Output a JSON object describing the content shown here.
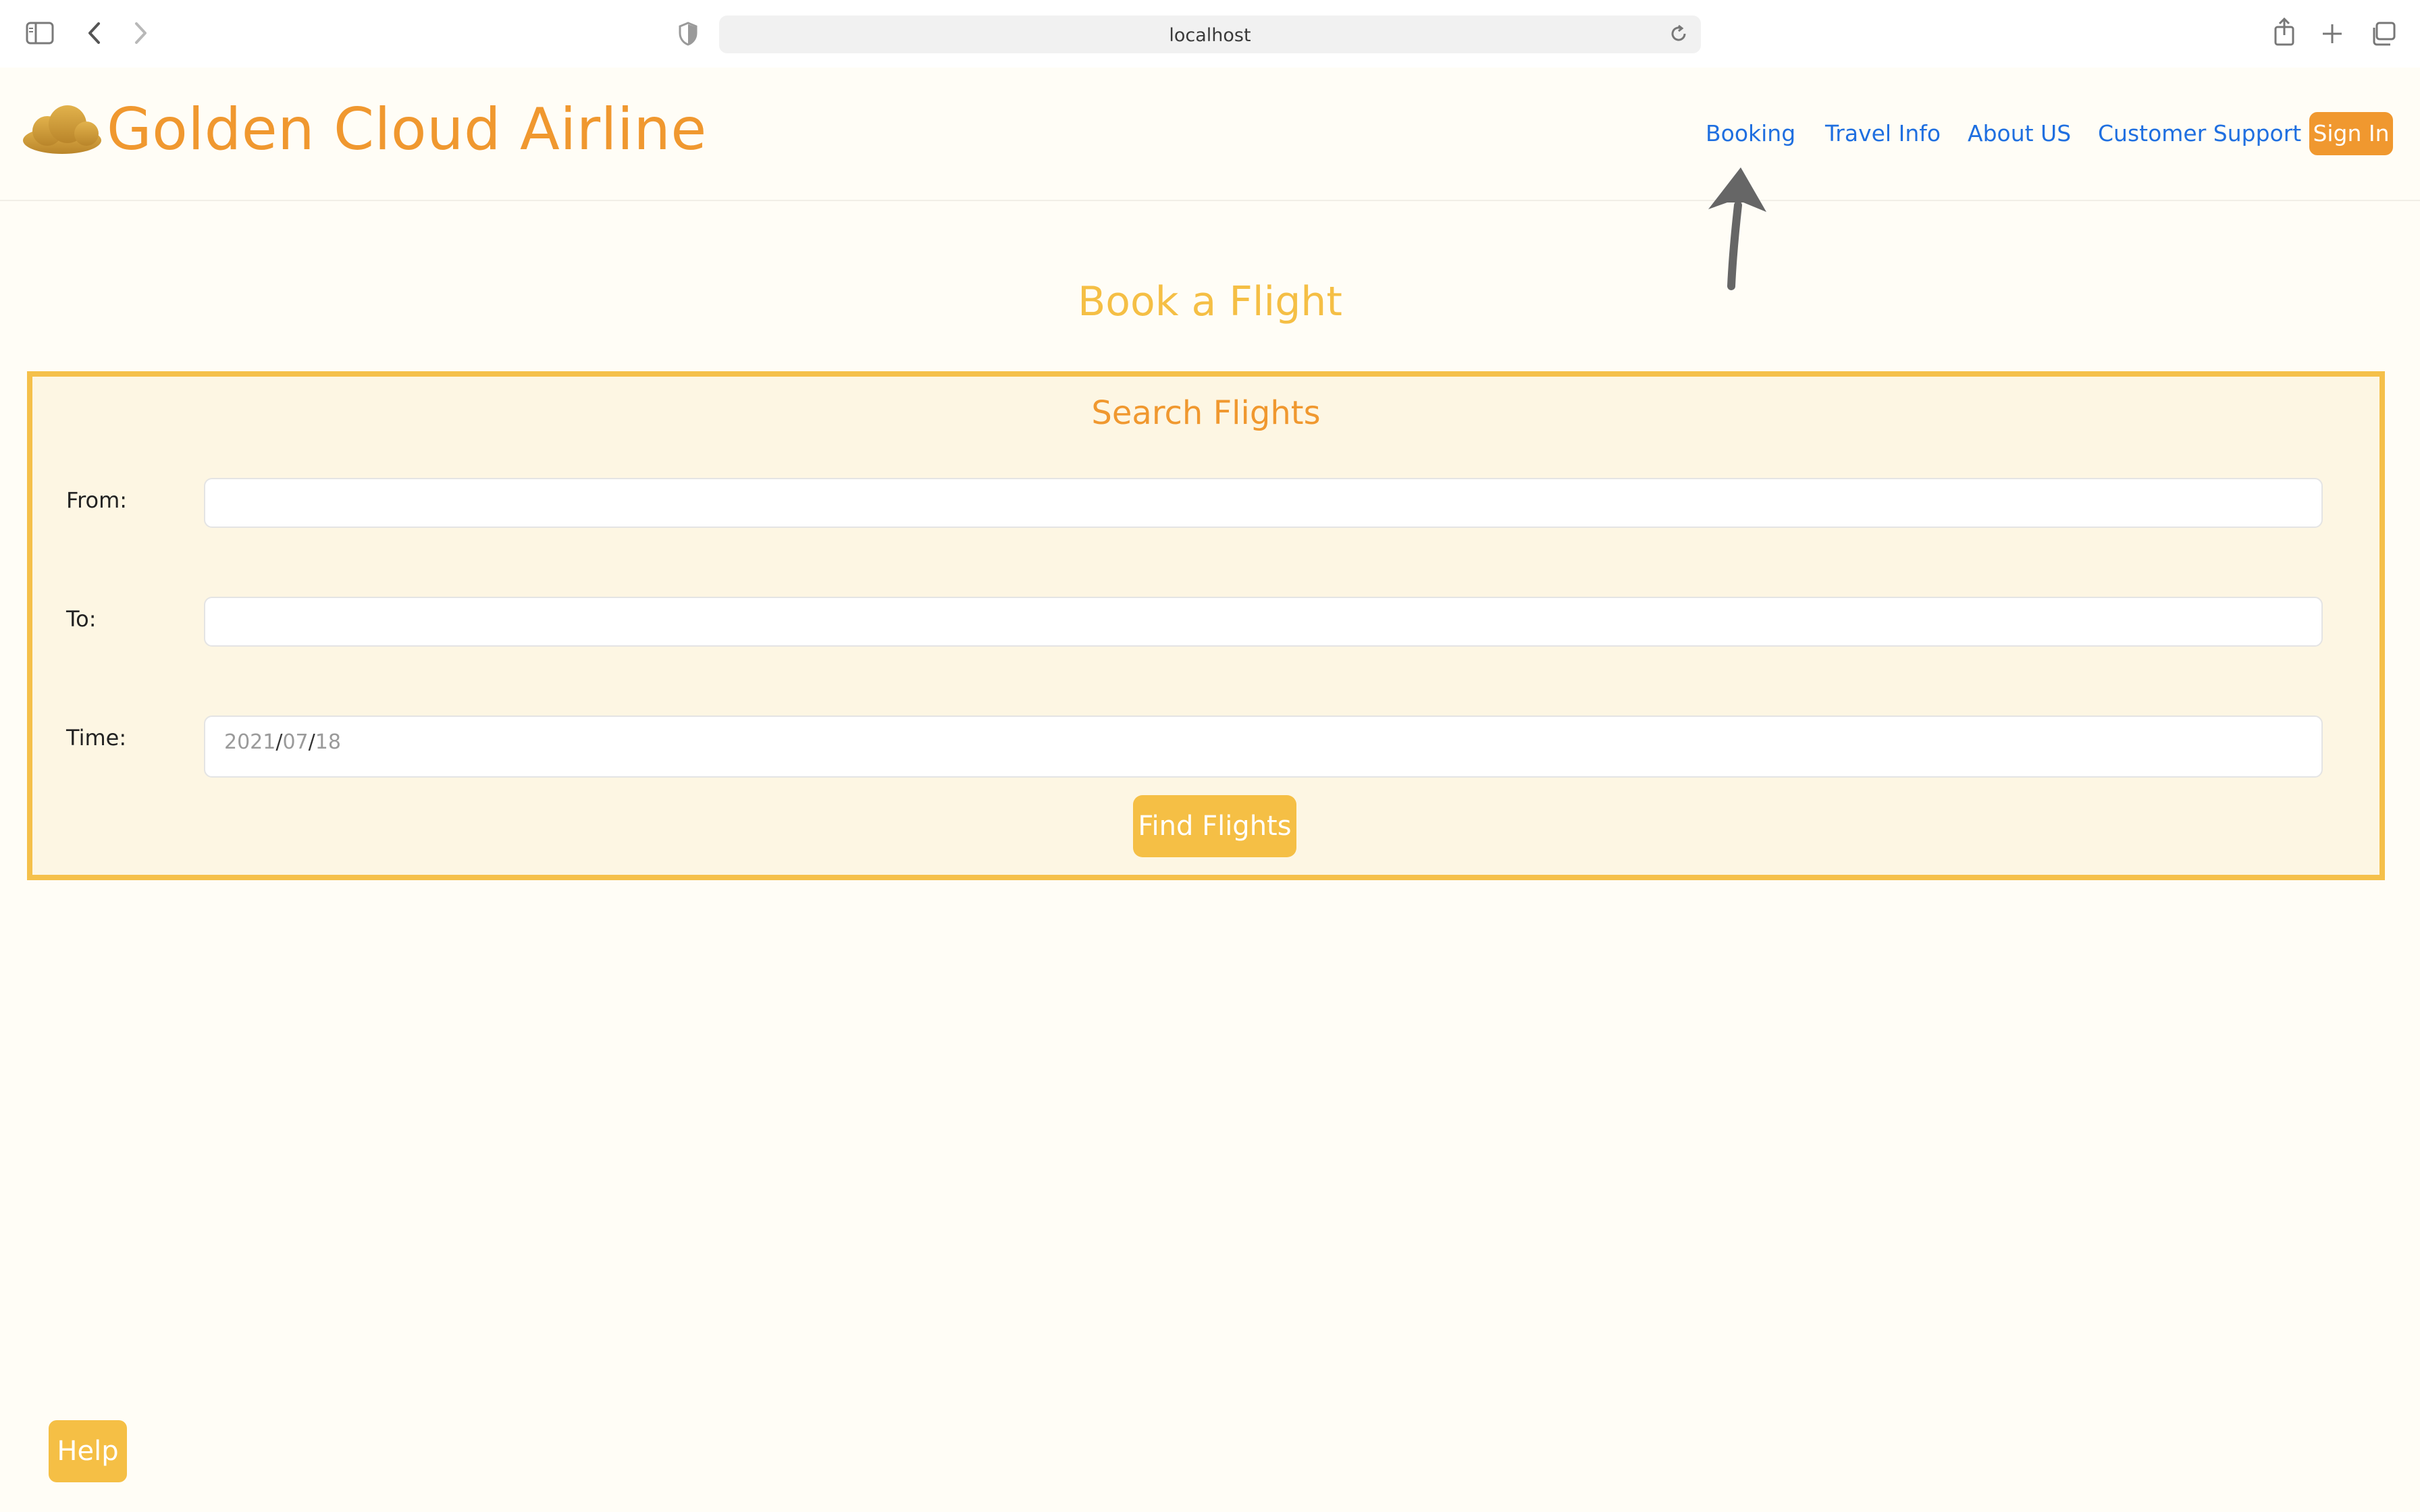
{
  "browser": {
    "url": "localhost"
  },
  "header": {
    "brand": "Golden Cloud Airline",
    "nav": {
      "booking": "Booking",
      "travel_info": "Travel Info",
      "about_us": "About US",
      "customer_support": "Customer Support"
    },
    "sign_in": "Sign In"
  },
  "main": {
    "title": "Book a Flight",
    "search": {
      "title": "Search Flights",
      "from_label": "From:",
      "to_label": "To:",
      "time_label": "Time:",
      "date": {
        "year": "2021",
        "month": "07",
        "day": "18",
        "separator": "/"
      },
      "find_button": "Find Flights"
    }
  },
  "help_button": "Help",
  "colors": {
    "brand_orange": "#f0982f",
    "accent_gold": "#f5bf45",
    "link_blue": "#1f6fe0",
    "page_bg": "#fffdf6",
    "panel_bg": "#fdf6e3"
  }
}
